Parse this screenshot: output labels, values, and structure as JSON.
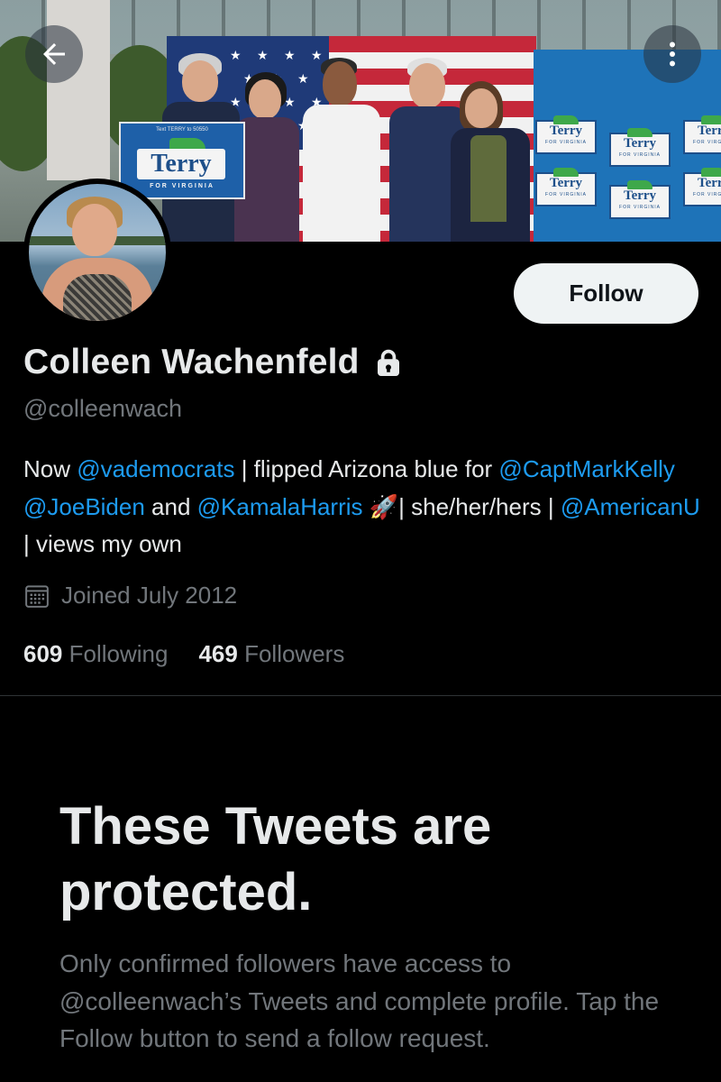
{
  "banner": {
    "podium_sign_small": "Text TERRY to 50550",
    "podium_sign_name": "Terry",
    "podium_sign_sub": "FOR VIRGINIA",
    "wall_sign_name": "Terry",
    "wall_sign_sub": "FOR VIRGINIA",
    "back_icon": "arrow-left-icon",
    "more_icon": "more-vertical-icon"
  },
  "profile": {
    "display_name": "Colleen Wachenfeld",
    "handle": "@colleenwach",
    "follow_label": "Follow",
    "bio": {
      "p1": "Now ",
      "l1": "@vademocrats",
      "p2": " | flipped Arizona blue for ",
      "l2": "@CaptMarkKelly",
      "p3": " ",
      "l3": "@JoeBiden",
      "p4": " and ",
      "l4": "@KamalaHarris",
      "p5": " 🚀| she/her/hers | ",
      "l5": "@AmericanU",
      "p6": " | views my own"
    },
    "joined": "Joined July 2012",
    "following_count": "609",
    "following_label": "Following",
    "followers_count": "469",
    "followers_label": "Followers"
  },
  "protected": {
    "title": "These Tweets are protected.",
    "body": "Only confirmed followers have access to @colleenwach’s Tweets and complete profile. Tap the Follow button to send a follow request."
  },
  "colors": {
    "background": "#000000",
    "text": "#e7e9ea",
    "secondary_text": "#71767b",
    "link": "#1d9bf0",
    "follow_button_bg": "#eff3f4"
  }
}
